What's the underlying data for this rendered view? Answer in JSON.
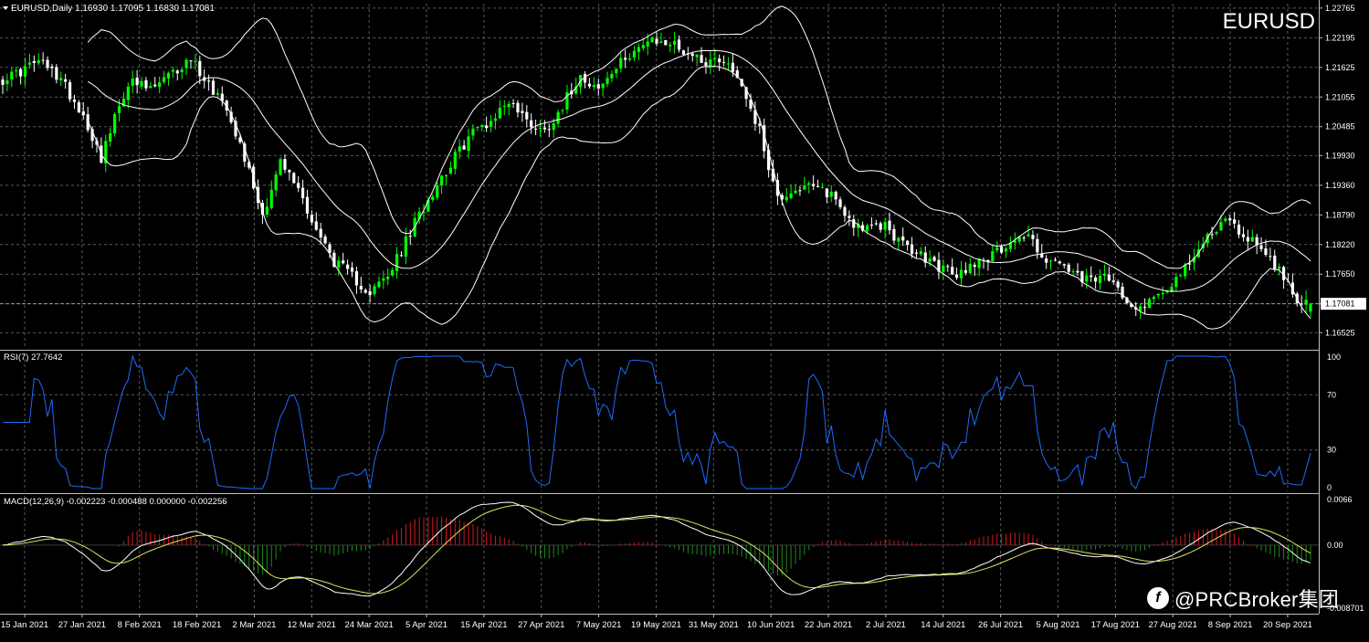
{
  "header": {
    "info": "EURUSD,Daily  1.16930 1.17095 1.16830 1.17081",
    "symbol": "EURUSD"
  },
  "current_price_label": "1.17081",
  "rsi_label": "RSI(7) 27.7642",
  "macd_label": "MACD(12,26,9) -0.002223 -0.000488 0.000000 -0.002256",
  "watermark": "@PRCBroker集团",
  "colors": {
    "background": "#000000",
    "grid": "#5a5a5a",
    "bull_candle": "#00ff00",
    "bear_candle": "#ffffff",
    "bollinger": "#ffffff",
    "rsi_line": "#1e6cff",
    "macd_hist_pos": "#d11a1a",
    "macd_hist_neg": "#1b8c1b",
    "macd_line": "#ffffff",
    "signal_line": "#e0e060"
  },
  "chart_data": [
    {
      "type": "candlestick",
      "symbol": "EURUSD",
      "timeframe": "Daily",
      "ylim": [
        1.1625,
        1.2285
      ],
      "y_ticks": [
        "1.22765",
        "1.22195",
        "1.21625",
        "1.21055",
        "1.20485",
        "1.19930",
        "1.19360",
        "1.18790",
        "1.18220",
        "1.17650",
        "1.17081",
        "1.16525"
      ],
      "x_tick_labels": [
        "15 Jan 2021",
        "27 Jan 2021",
        "8 Feb 2021",
        "18 Feb 2021",
        "2 Mar 2021",
        "12 Mar 2021",
        "24 Mar 2021",
        "5 Apr 2021",
        "15 Apr 2021",
        "27 Apr 2021",
        "7 May 2021",
        "19 May 2021",
        "31 May 2021",
        "10 Jun 2021",
        "22 Jun 2021",
        "2 Jul 2021",
        "14 Jul 2021",
        "26 Jul 2021",
        "5 Aug 2021",
        "17 Aug 2021",
        "27 Aug 2021",
        "8 Sep 2021",
        "20 Sep 2021"
      ],
      "close_anchors": [
        [
          0,
          1.214
        ],
        [
          3,
          1.215
        ],
        [
          8,
          1.2175
        ],
        [
          13,
          1.214
        ],
        [
          18,
          1.207
        ],
        [
          22,
          1.199
        ],
        [
          28,
          1.2135
        ],
        [
          33,
          1.212
        ],
        [
          38,
          1.215
        ],
        [
          42,
          1.218
        ],
        [
          46,
          1.213
        ],
        [
          50,
          1.209
        ],
        [
          54,
          1.199
        ],
        [
          58,
          1.188
        ],
        [
          62,
          1.198
        ],
        [
          66,
          1.193
        ],
        [
          70,
          1.185
        ],
        [
          74,
          1.179
        ],
        [
          78,
          1.176
        ],
        [
          82,
          1.173
        ],
        [
          86,
          1.176
        ],
        [
          89,
          1.181
        ],
        [
          93,
          1.188
        ],
        [
          97,
          1.194
        ],
        [
          101,
          1.199
        ],
        [
          105,
          1.204
        ],
        [
          109,
          1.206
        ],
        [
          113,
          1.21
        ],
        [
          117,
          1.206
        ],
        [
          121,
          1.204
        ],
        [
          125,
          1.209
        ],
        [
          129,
          1.215
        ],
        [
          133,
          1.212
        ],
        [
          137,
          1.216
        ],
        [
          141,
          1.22
        ],
        [
          145,
          1.221
        ],
        [
          149,
          1.221
        ],
        [
          153,
          1.219
        ],
        [
          157,
          1.2175
        ],
        [
          161,
          1.218
        ],
        [
          165,
          1.213
        ],
        [
          169,
          1.204
        ],
        [
          173,
          1.191
        ],
        [
          177,
          1.193
        ],
        [
          181,
          1.193
        ],
        [
          185,
          1.192
        ],
        [
          189,
          1.187
        ],
        [
          193,
          1.185
        ],
        [
          197,
          1.186
        ],
        [
          201,
          1.182
        ],
        [
          205,
          1.18
        ],
        [
          209,
          1.178
        ],
        [
          213,
          1.176
        ],
        [
          217,
          1.179
        ],
        [
          221,
          1.18
        ],
        [
          225,
          1.183
        ],
        [
          229,
          1.184
        ],
        [
          233,
          1.179
        ],
        [
          237,
          1.178
        ],
        [
          241,
          1.175
        ],
        [
          245,
          1.176
        ],
        [
          249,
          1.174
        ],
        [
          253,
          1.17
        ],
        [
          257,
          1.172
        ],
        [
          261,
          1.175
        ],
        [
          265,
          1.178
        ],
        [
          269,
          1.184
        ],
        [
          273,
          1.187
        ],
        [
          277,
          1.184
        ],
        [
          281,
          1.182
        ],
        [
          285,
          1.177
        ],
        [
          289,
          1.172
        ],
        [
          292,
          1.1708
        ]
      ],
      "last_candle": {
        "open": 1.1693,
        "high": 1.17095,
        "low": 1.1683,
        "close": 1.17081
      }
    },
    {
      "type": "line",
      "name": "RSI(7)",
      "current": 27.7642,
      "ylim": [
        0,
        100
      ],
      "y_ticks": [
        "100",
        "70",
        "30",
        "0"
      ],
      "levels": [
        70,
        30
      ]
    },
    {
      "type": "macd",
      "name": "MACD(12,26,9)",
      "values": [
        -0.002223,
        -0.000488,
        0.0,
        -0.002256
      ],
      "ylim": [
        -0.008701,
        0.0066
      ],
      "y_ticks": [
        "0.0066",
        "0.00",
        "-0.008701"
      ]
    }
  ]
}
